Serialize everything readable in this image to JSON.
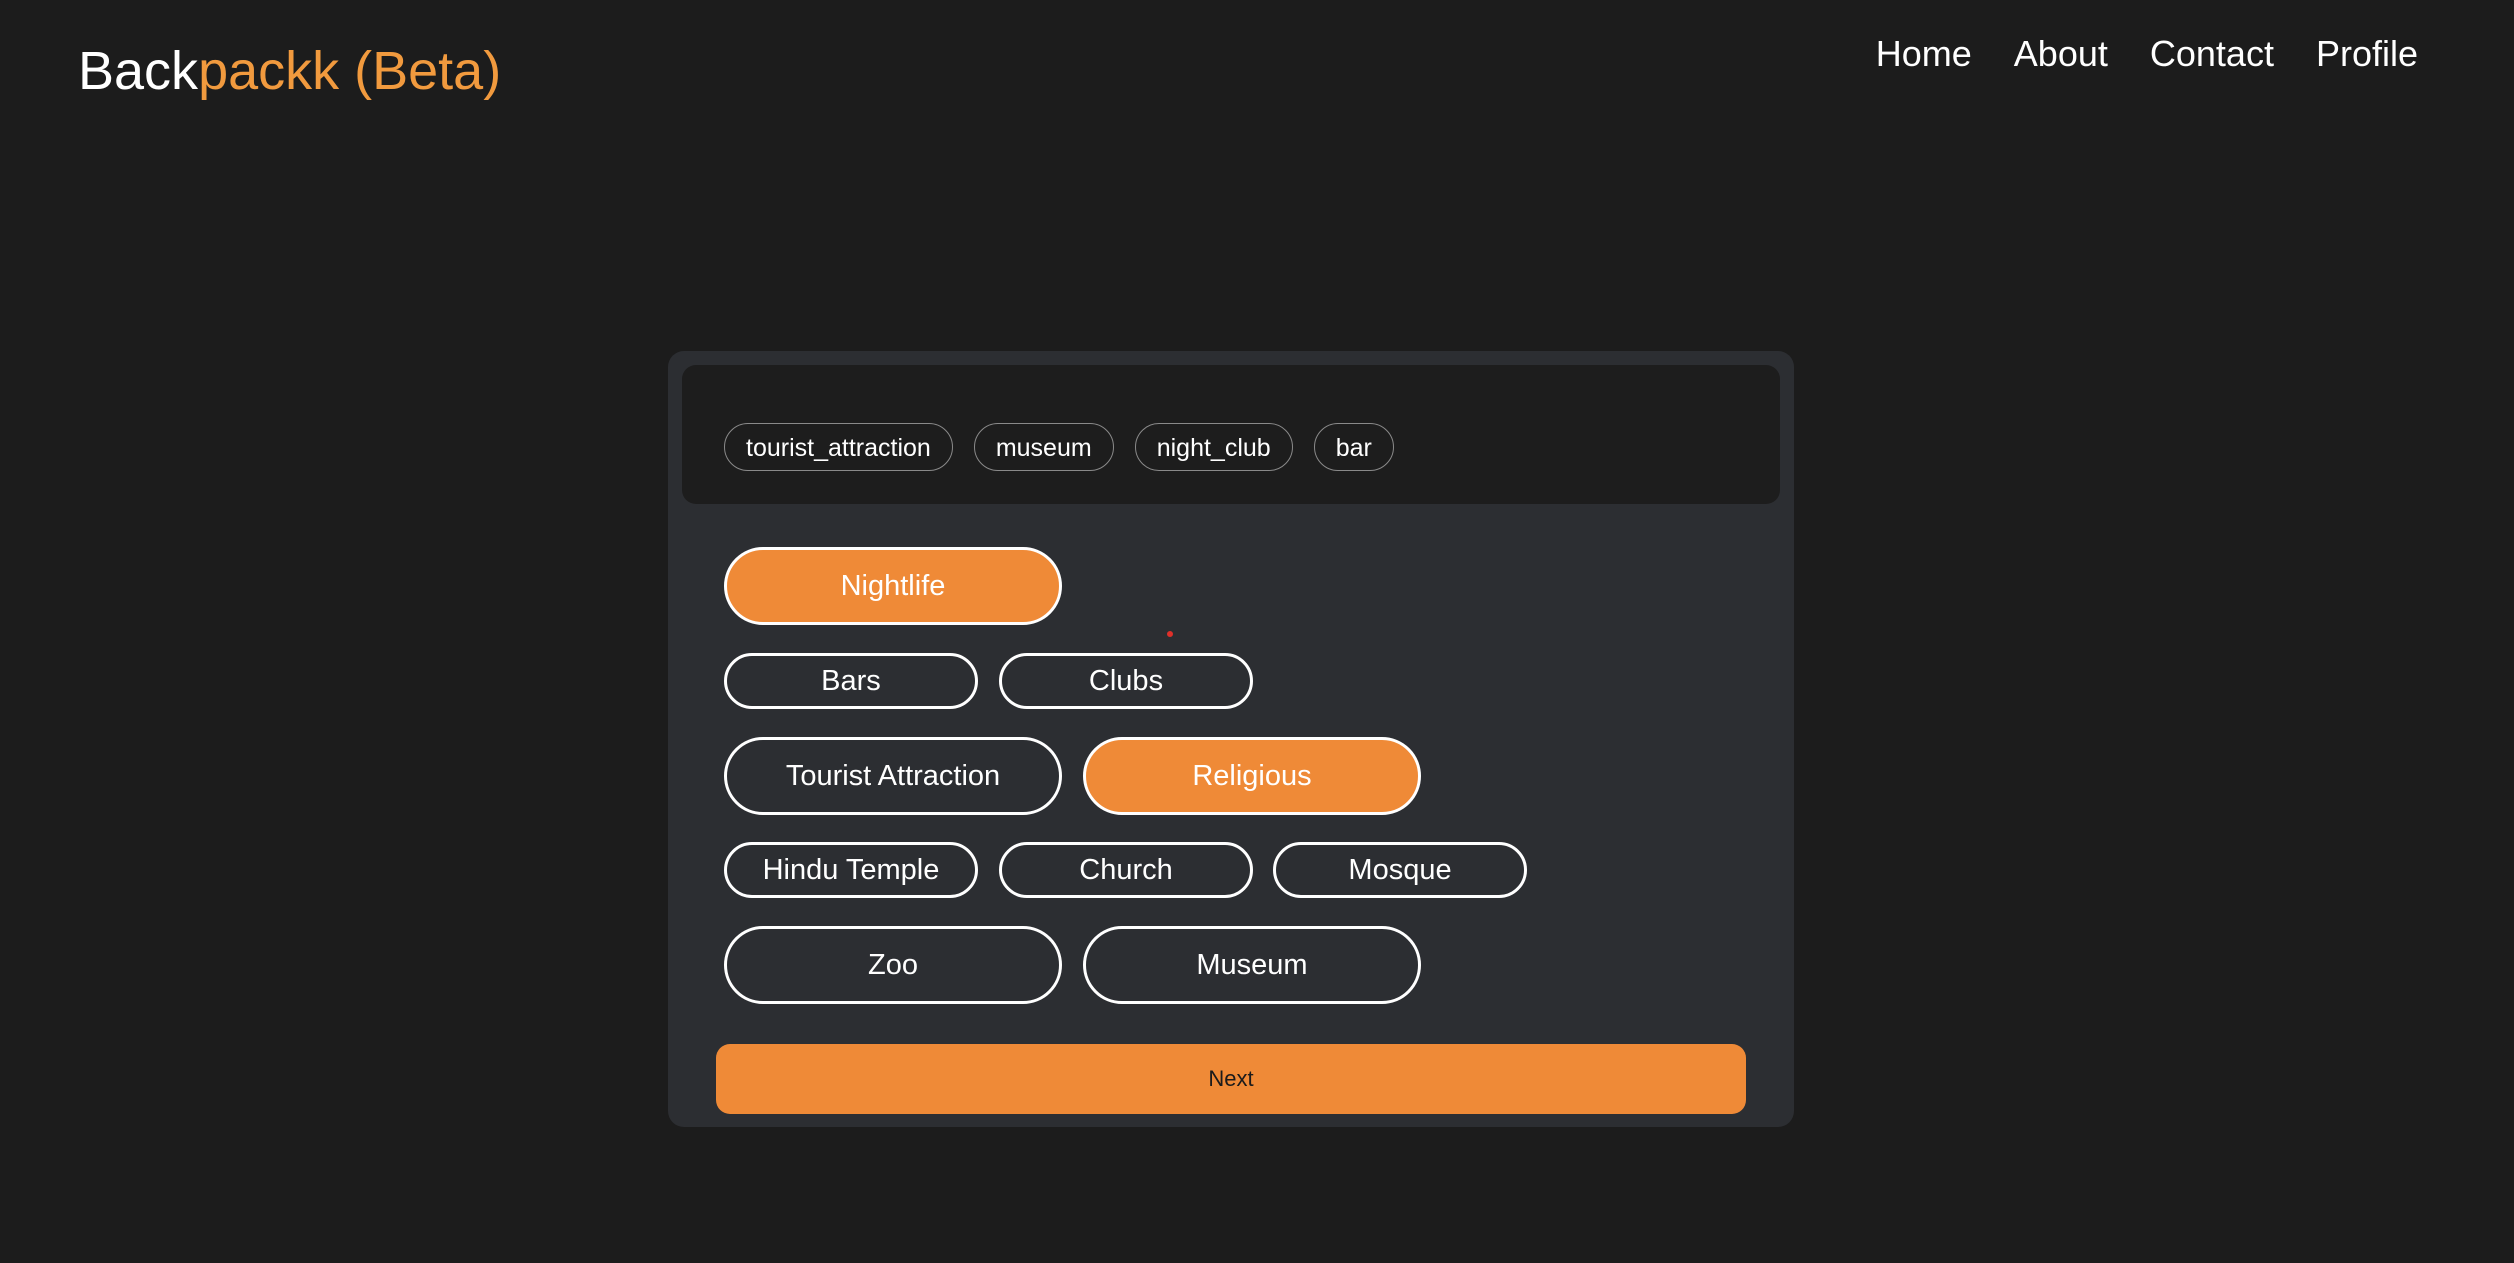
{
  "header": {
    "logo_part1": "Back",
    "logo_part2": "packk (Beta)",
    "nav": [
      "Home",
      "About",
      "Contact",
      "Profile"
    ]
  },
  "selected_tags": [
    "tourist_attraction",
    "museum",
    "night_club",
    "bar"
  ],
  "categories": {
    "nightlife": "Nightlife",
    "bars": "Bars",
    "clubs": "Clubs",
    "tourist_attraction": "Tourist Attraction",
    "religious": "Religious",
    "hindu_temple": "Hindu Temple",
    "church": "Church",
    "mosque": "Mosque",
    "zoo": "Zoo",
    "museum": "Museum"
  },
  "next_label": "Next",
  "colors": {
    "accent": "#ef8a37",
    "background": "#1c1c1c",
    "card": "#2c2e32"
  }
}
